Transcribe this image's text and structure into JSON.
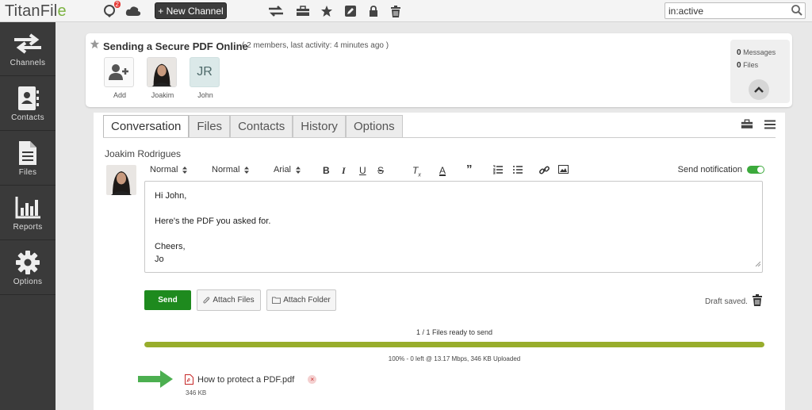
{
  "app": {
    "logo_text": "TitanFil",
    "logo_accent": "e",
    "accent_color": "#7cb342"
  },
  "topbar": {
    "notifications_count": "2",
    "new_channel_label": "+ New Channel",
    "search_value": "in:active"
  },
  "sidebar": {
    "items": [
      {
        "label": "Channels",
        "icon": "exchange-arrows-icon"
      },
      {
        "label": "Contacts",
        "icon": "address-book-icon"
      },
      {
        "label": "Files",
        "icon": "file-icon"
      },
      {
        "label": "Reports",
        "icon": "bar-chart-icon"
      },
      {
        "label": "Options",
        "icon": "gear-icon"
      }
    ]
  },
  "channel": {
    "title": "Sending a Secure PDF Online",
    "meta": "( 2 members, last activity: 4 minutes ago )",
    "members": [
      {
        "label": "Add",
        "type": "add"
      },
      {
        "label": "Joakim",
        "type": "photo"
      },
      {
        "label": "John",
        "type": "initials",
        "initials": "JR"
      }
    ],
    "stats": {
      "messages_count": "0",
      "messages_label": "Messages",
      "files_count": "0",
      "files_label": "Files"
    }
  },
  "tabs": [
    {
      "label": "Conversation",
      "active": true
    },
    {
      "label": "Files",
      "active": false
    },
    {
      "label": "Contacts",
      "active": false
    },
    {
      "label": "History",
      "active": false
    },
    {
      "label": "Options",
      "active": false
    }
  ],
  "composer": {
    "author": "Joakim Rodrigues",
    "toolbar": {
      "style_select": "Normal",
      "size_select": "Normal",
      "font_select": "Arial",
      "send_notification_label": "Send notification",
      "send_notification_on": true
    },
    "message_lines": [
      "Hi John,",
      "",
      "Here's the PDF you asked for.",
      "",
      "Cheers,",
      "Jo"
    ],
    "send_label": "Send",
    "attach_files_label": "Attach Files",
    "attach_folder_label": "Attach Folder",
    "draft_status": "Draft saved."
  },
  "upload": {
    "files_ready": "1 / 1 Files ready to send",
    "progress": 1.0,
    "status": "100% - 0 left @ 13.17 Mbps, 346 KB Uploaded",
    "file_name": "How to protect a PDF.pdf",
    "file_size": "346 KB",
    "progress_color": "#98ad2c"
  }
}
